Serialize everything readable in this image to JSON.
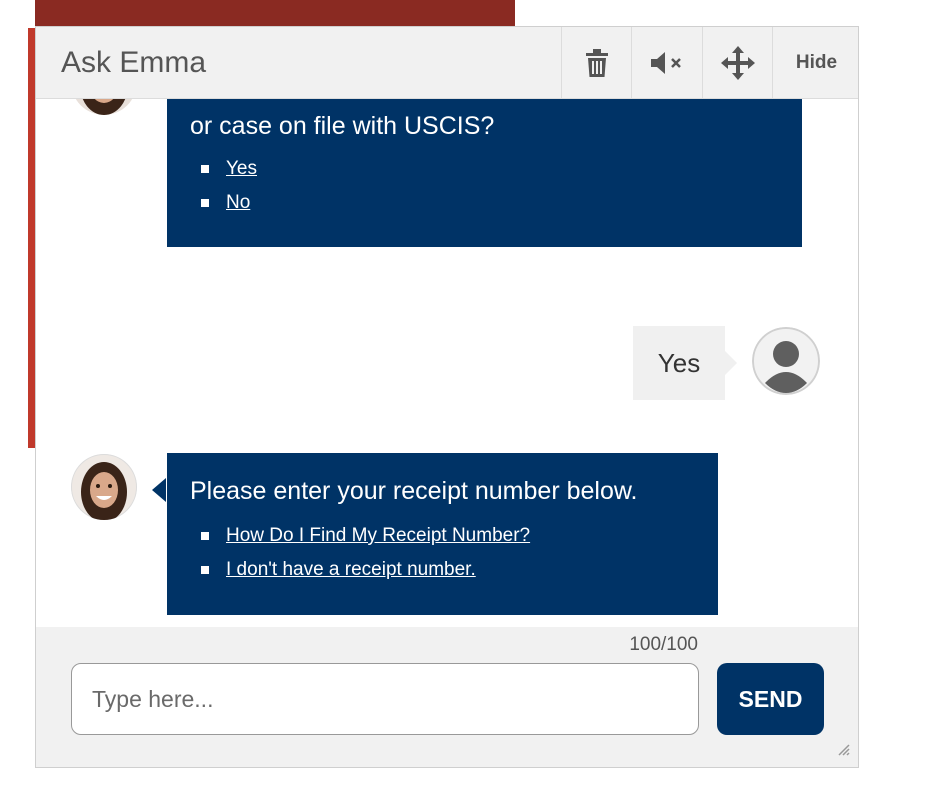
{
  "header": {
    "title": "Ask Emma",
    "hide_label": "Hide",
    "icons": [
      "trash-icon",
      "mute-icon",
      "move-icon"
    ]
  },
  "messages": {
    "first": {
      "question": "or case on file with USCIS?",
      "options": [
        "Yes",
        "No"
      ]
    },
    "user_reply": "Yes",
    "second": {
      "question": "Please enter your receipt number below.",
      "options": [
        "How Do I Find My Receipt Number?",
        "I don't have a receipt number."
      ]
    }
  },
  "footer": {
    "counter": "100/100",
    "input_placeholder": "Type here...",
    "send_label": "SEND"
  },
  "colors": {
    "brand_navy": "#003366",
    "header_bg": "#f1f1f1",
    "user_bubble_bg": "#f0f0f0"
  }
}
